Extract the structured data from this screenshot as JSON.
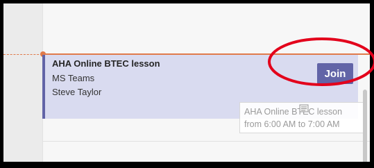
{
  "event": {
    "title": "AHA Online BTEC lesson",
    "location": "MS Teams",
    "organizer": "Steve Taylor",
    "join_label": "Join"
  },
  "tooltip": {
    "line1": "AHA Online BTEC lesson",
    "line2": "from 6:00 AM to 7:00 AM"
  },
  "colors": {
    "accent": "#6264a7",
    "event_bg": "#d9dbf0",
    "now_line": "#e07a4a",
    "annotation": "#e3001b"
  },
  "icons": {
    "tooltip_icon": "calendar-event-icon"
  }
}
